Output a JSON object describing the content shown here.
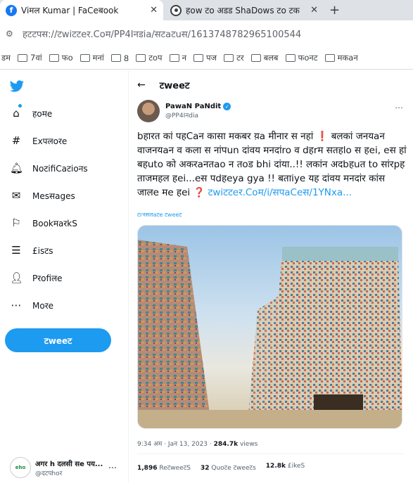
{
  "browser": {
    "tabs": [
      {
        "title": "Viमल Kumar | FaCeबook",
        "icon": "facebook-icon"
      },
      {
        "title": "हow टo अडड ShaDows टo टक",
        "icon": "generic-site-icon"
      }
    ],
    "close_glyph": "✕",
    "new_tab_glyph": "+",
    "url": "हटटपस://टwiटटeर.Coम/PP4Iनडia/सटaटuस/1613748782965100544",
    "bookmarks": [
      "डम",
      "7वां",
      "फo",
      "मनां",
      "8",
      "टoप",
      "न",
      "पज",
      "टर",
      "बलब",
      "फoनट",
      "मकaन"
    ]
  },
  "nav": {
    "items": [
      {
        "label": "हoमe",
        "icon": "home-icon",
        "glyph": "⌂"
      },
      {
        "label": "Exपलoरe",
        "icon": "hashtag-icon",
        "glyph": "#"
      },
      {
        "label": "NoटifiCaटioनs",
        "icon": "bell-icon",
        "glyph": "🔔︎"
      },
      {
        "label": "Mesसages",
        "icon": "mail-icon",
        "glyph": "✉"
      },
      {
        "label": "BookमaरkS",
        "icon": "bookmark-icon",
        "glyph": "⚐"
      },
      {
        "label": "£isटs",
        "icon": "list-icon",
        "glyph": "☰"
      },
      {
        "label": "Pरofiलe",
        "icon": "profile-icon",
        "glyph": "👤︎"
      },
      {
        "label": "Moरe",
        "icon": "more-circle-icon",
        "glyph": "⋯"
      }
    ],
    "tweet_button": "टweeट",
    "account": {
      "name": "अगर h दलसी सe पय...",
      "handle": "@दटपhoर",
      "avatar_text": "eho"
    }
  },
  "tweet": {
    "header": "टweeट",
    "author_name": "PawaN PaNdit",
    "author_handle": "@PP4Iनdia",
    "text": "bहारत कां पहCaन कासा मकबर य़a मीनार स नहां ❗ बलकां जनयaन वाजनयaन व कला स नांपun दांवय मनदांro व dहrम सतहlo स हei, eस हां बहuto को अकरaनतao न तoड bhi दांया..!! लकांन अदbहuत to सांरpह ताजमहल हei...eस पdहeya gya !! बताiye यह दांवय मनदांर कांस जालe मe हei ❓",
    "link": "टwiटटeर.Coम/i/सपaCeस/1YNxa...",
    "translate": "टrनसलaटe टweeट",
    "time": "9:34 अम · Jaन 13, 2023 ·",
    "views_count": "284.7k",
    "views_label": "views",
    "retweets_count": "1,896",
    "retweets_label": "ReटweeटS",
    "quotes_count": "32",
    "quotes_label": "Quoटe टweeटs",
    "likes_count": "12.8k",
    "likes_label": "£ikeS"
  },
  "colors": {
    "accent": "#1d9bf0",
    "text": "#0f1419",
    "muted": "#536471"
  }
}
